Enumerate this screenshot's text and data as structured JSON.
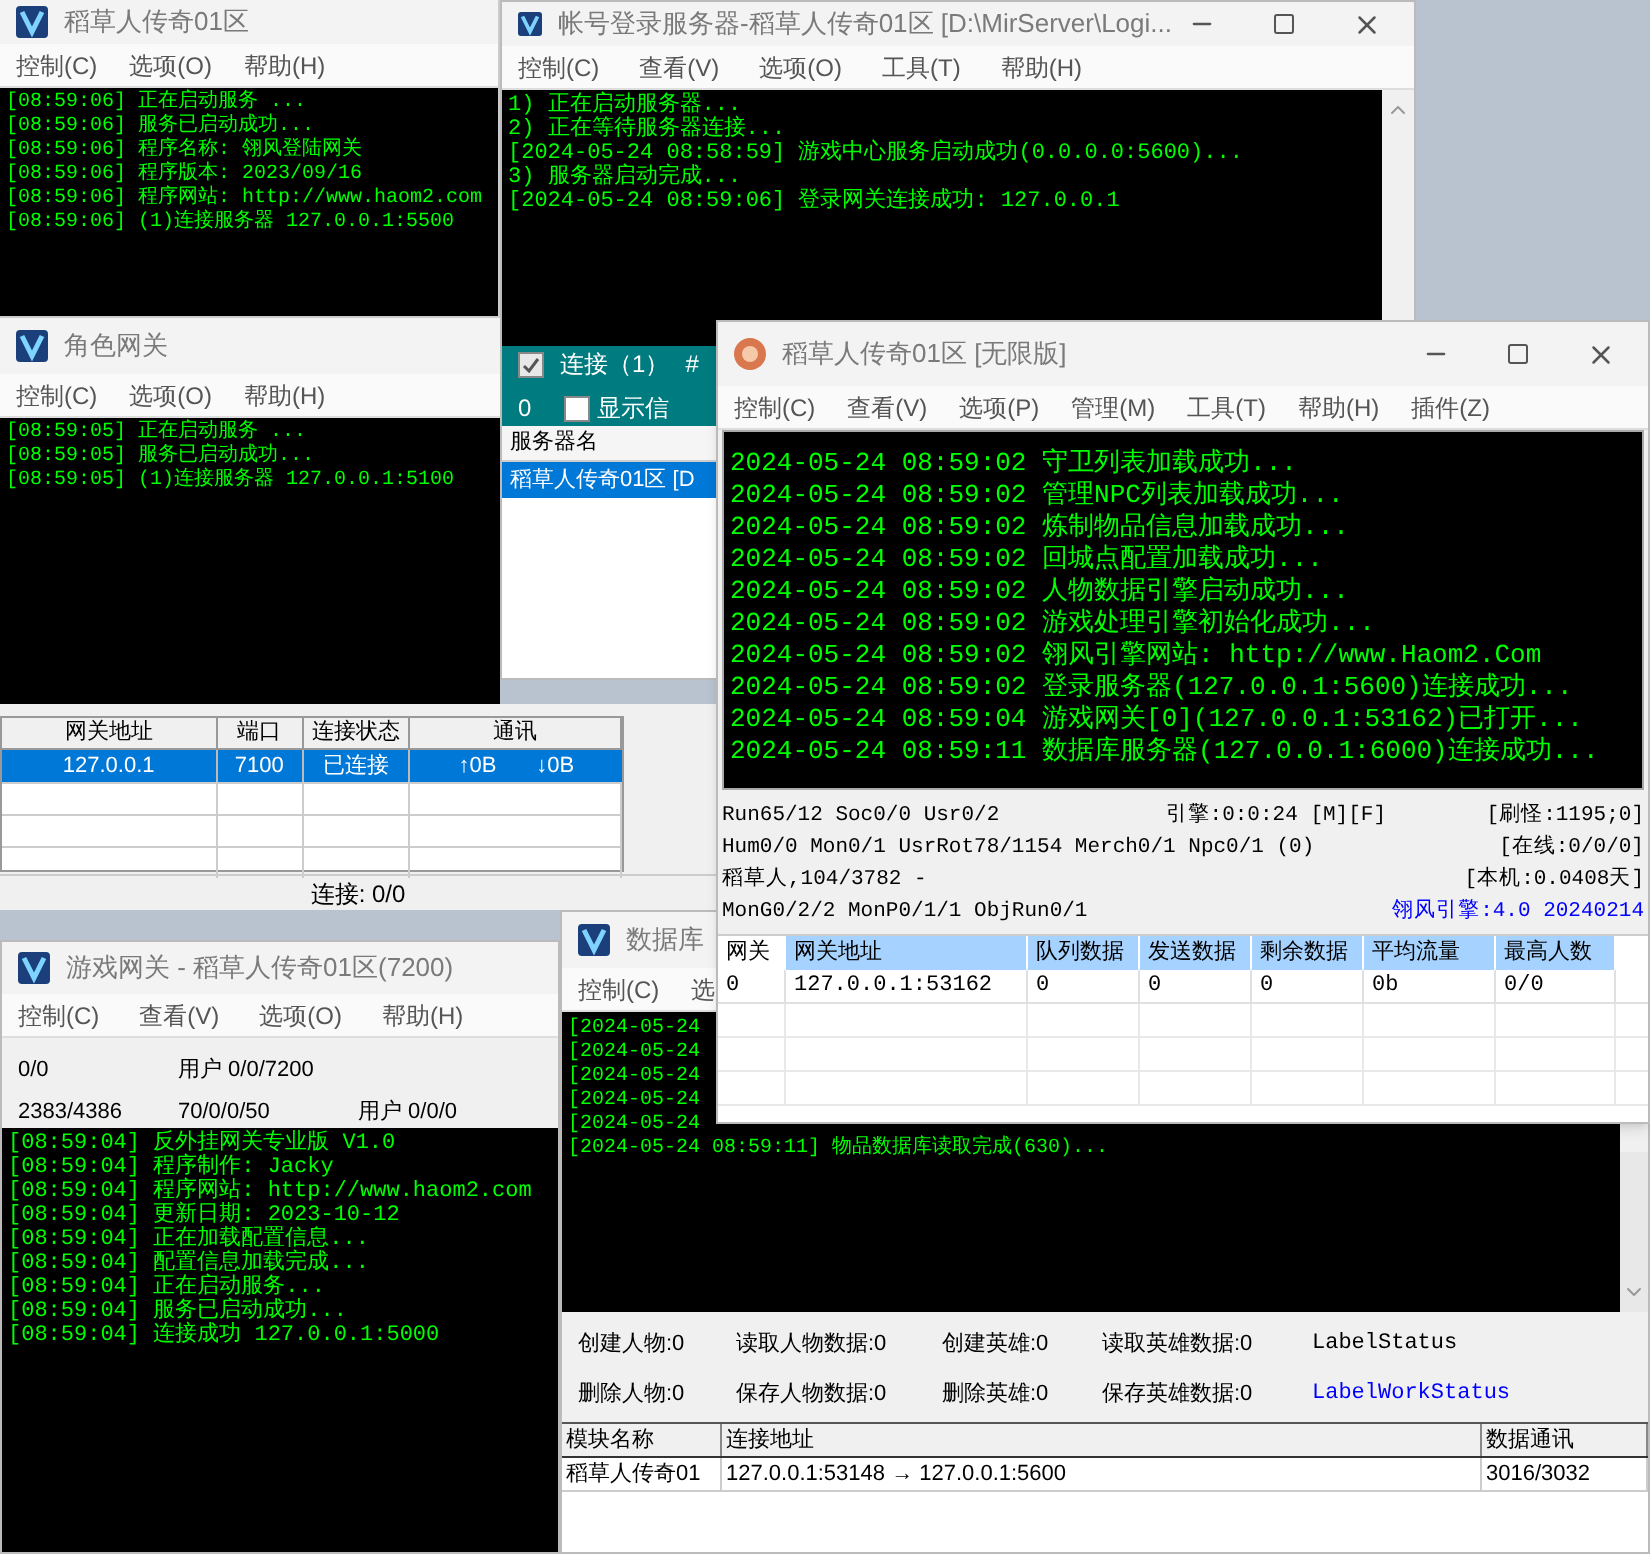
{
  "login_gate": {
    "title": "稻草人传奇01区",
    "menu": [
      "控制(C)",
      "选项(O)",
      "帮助(H)"
    ],
    "log": [
      "[08:59:06] 正在启动服务 ...",
      "[08:59:06] 服务已启动成功...",
      "[08:59:06] 程序名称: 翎风登陆网关",
      "[08:59:06] 程序版本: 2023/09/16",
      "[08:59:06] 程序网站: http://www.haom2.com",
      "[08:59:06] (1)连接服务器 127.0.0.1:5500"
    ]
  },
  "role_gate": {
    "title": "角色网关",
    "menu": [
      "控制(C)",
      "选项(O)",
      "帮助(H)"
    ],
    "log": [
      "[08:59:05] 正在启动服务 ...",
      "[08:59:05] 服务已启动成功...",
      "[08:59:05] (1)连接服务器 127.0.0.1:5100"
    ]
  },
  "gate_list": {
    "columns": [
      "网关地址",
      "端口",
      "连接状态",
      "通讯"
    ],
    "rows": [
      {
        "selected": true,
        "address": "127.0.0.1",
        "port": "7100",
        "status": "已连接",
        "up": "↑0B",
        "down": "↓0B"
      }
    ],
    "status": "连接: 0/0"
  },
  "login_server": {
    "title": "帐号登录服务器-稻草人传奇01区  [D:\\MirServer\\Logi...",
    "menu": [
      "控制(C)",
      "查看(V)",
      "选项(O)",
      "工具(T)",
      "帮助(H)"
    ],
    "log": [
      "1) 正在启动服务器...",
      "2) 正在等待服务器连接...",
      "[2024-05-24 08:58:59] 游戏中心服务启动成功(0.0.0.0:5600)...",
      "3) 服务器启动完成...",
      "[2024-05-24 08:59:06] 登录网关连接成功: 127.0.0.1"
    ],
    "connect": {
      "label": "连接（1）",
      "checked": true
    },
    "hash": "#",
    "count": "0",
    "show_info": {
      "label": "显示信",
      "checked": false
    },
    "list_column": "服务器名",
    "servers": [
      {
        "name": "稻草人传奇01区 [D",
        "selected": true
      }
    ]
  },
  "game_gate": {
    "title": "游戏网关 - 稻草人传奇01区(7200)",
    "menu": [
      "控制(C)",
      "查看(V)",
      "选项(O)",
      "帮助(H)"
    ],
    "stats": [
      [
        "0/0",
        "用户 0/0/7200"
      ],
      [
        "2383/4386",
        "70/0/0/50",
        "用户 0/0/0"
      ]
    ],
    "log": [
      "[08:59:04] 反外挂网关专业版 V1.0",
      "[08:59:04] 程序制作: Jacky",
      "[08:59:04] 程序网站: http://www.haom2.com",
      "[08:59:04] 更新日期: 2023-10-12",
      "[08:59:04] 正在加载配置信息...",
      "[08:59:04] 配置信息加载完成...",
      "[08:59:04] 正在启动服务...",
      "[08:59:04] 服务已启动成功...",
      "[08:59:04] 连接成功 127.0.0.1:5000"
    ]
  },
  "db_server": {
    "title": "数据库",
    "menu": [
      "控制(C)",
      "选"
    ],
    "log": [
      "[2024-05-24",
      "[2024-05-24",
      "[2024-05-24",
      "[2024-05-24",
      "[2024-05-24",
      "[2024-05-24 08:59:11] 物品数据库读取完成(630)..."
    ],
    "stats": [
      [
        {
          "text": "创建人物:0"
        },
        {
          "text": "读取人物数据:0"
        },
        {
          "text": "创建英雄:0"
        },
        {
          "text": "读取英雄数据:0"
        },
        {
          "text": "LabelStatus",
          "color": "#000000"
        }
      ],
      [
        {
          "text": "删除人物:0"
        },
        {
          "text": "保存人物数据:0"
        },
        {
          "text": "删除英雄:0"
        },
        {
          "text": "保存英雄数据:0"
        },
        {
          "text": "LabelWorkStatus",
          "color": "#0000ff"
        }
      ]
    ],
    "columns": [
      "模块名称",
      "连接地址",
      "数据通讯"
    ],
    "rows": [
      [
        "稻草人传奇01",
        "127.0.0.1:53148 → 127.0.0.1:5600",
        "3016/3032"
      ]
    ]
  },
  "m2_server": {
    "title": "稻草人传奇01区 [无限版]",
    "menu": [
      "控制(C)",
      "查看(V)",
      "选项(P)",
      "管理(M)",
      "工具(T)",
      "帮助(H)",
      "插件(Z)"
    ],
    "log": [
      "2024-05-24 08:59:02 守卫列表加载成功...",
      "2024-05-24 08:59:02 管理NPC列表加载成功...",
      "2024-05-24 08:59:02 炼制物品信息加载成功...",
      "2024-05-24 08:59:02 回城点配置加载成功...",
      "2024-05-24 08:59:02 人物数据引擎启动成功...",
      "2024-05-24 08:59:02 游戏处理引擎初始化成功...",
      "2024-05-24 08:59:02 翎风引擎网站: http://www.Haom2.Com",
      "2024-05-24 08:59:02 登录服务器(127.0.0.1:5600)连接成功...",
      "2024-05-24 08:59:04 游戏网关[0](127.0.0.1:53162)已打开...",
      "2024-05-24 08:59:11 数据库服务器(127.0.0.1:6000)连接成功..."
    ],
    "status": [
      {
        "left": [
          "Run65/12 Soc0/0 Usr0/2",
          "引擎:0:0:24 [M][F]"
        ],
        "right": {
          "text": "[刷怪:1195;0]",
          "color": "#000000"
        }
      },
      {
        "left": [
          "Hum0/0 Mon0/1 UsrRot78/1154 Merch0/1 Npc0/1 (0)"
        ],
        "right": {
          "text": "[在线:0/0/0]",
          "color": "#000000"
        }
      },
      {
        "left": [
          "稻草人,104/3782 -"
        ],
        "right": {
          "text": "[本机:0.0408天]",
          "color": "#000000"
        }
      },
      {
        "left": [
          "MonG0/2/2 MonP0/1/1 ObjRun0/1"
        ],
        "right": {
          "text": "翎风引擎:4.0 20240214",
          "color": "#0000ff"
        }
      }
    ],
    "columns": [
      "网关",
      "网关地址",
      "队列数据",
      "发送数据",
      "剩余数据",
      "平均流量",
      "最高人数"
    ],
    "rows": [
      [
        "0",
        "127.0.0.1:53162",
        "0",
        "0",
        "0",
        "0b",
        "0/0"
      ]
    ]
  }
}
